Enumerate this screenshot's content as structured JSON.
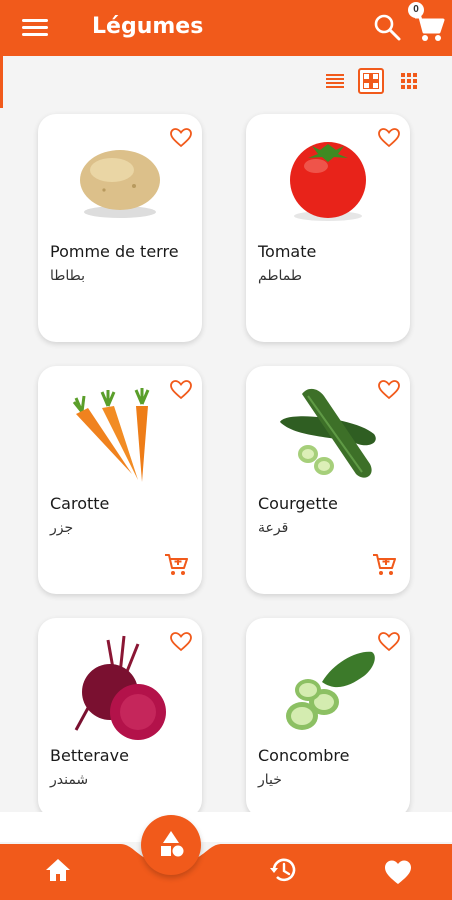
{
  "header": {
    "title": "Légumes",
    "cart_count": "0",
    "menu_icon": "hamburger-icon",
    "search_icon": "search-icon",
    "cart_icon": "cart-icon"
  },
  "view_modes": [
    "list-view-icon",
    "grid-view-icon",
    "small-grid-view-icon"
  ],
  "active_view": "grid-view-icon",
  "products": [
    {
      "name": "Pomme de terre",
      "arabic": "بطاطا"
    },
    {
      "name": "Tomate",
      "arabic": "طماطم"
    },
    {
      "name": "Carotte",
      "arabic": "جزر"
    },
    {
      "name": "Courgette",
      "arabic": "قرعة"
    },
    {
      "name": "Betterave",
      "arabic": "شمندر"
    },
    {
      "name": "Concombre",
      "arabic": "خيار"
    }
  ],
  "bottom_nav": [
    "home-icon",
    "categories-icon",
    "history-icon",
    "favorites-icon"
  ],
  "colors": {
    "accent": "#f15a1b",
    "background": "#f4f4f4",
    "card": "#ffffff"
  }
}
